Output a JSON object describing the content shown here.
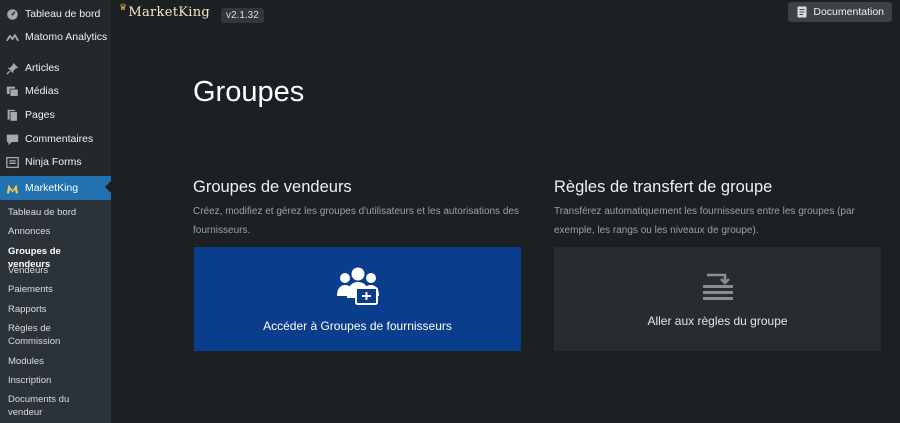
{
  "sidebar": {
    "items": [
      {
        "label": "Tableau de bord",
        "icon": "dashboard-icon"
      },
      {
        "label": "Matomo Analytics",
        "icon": "analytics-icon"
      },
      {
        "label": "Articles",
        "icon": "pin-icon"
      },
      {
        "label": "Médias",
        "icon": "media-icon"
      },
      {
        "label": "Pages",
        "icon": "pages-icon"
      },
      {
        "label": "Commentaires",
        "icon": "comments-icon"
      },
      {
        "label": "Ninja Forms",
        "icon": "forms-icon"
      },
      {
        "label": "MarketKing",
        "icon": "marketking-icon"
      }
    ],
    "submenu": [
      "Tableau de bord",
      "Annonces",
      "Groupes de vendeurs",
      "Vendeurs",
      "Paiements",
      "Rapports",
      "Règles de Commission",
      "Modules",
      "Inscription",
      "Documents du vendeur"
    ],
    "active_color": "#2271b1"
  },
  "topbar": {
    "logo_text": "MarketKing",
    "version": "v2.1.32",
    "doc_label": "Documentation"
  },
  "main": {
    "title": "Groupes",
    "cards": [
      {
        "title": "Groupes de vendeurs",
        "description": "Créez, modifiez et gérez les groupes d'utilisateurs et les autorisations des fournisseurs.",
        "action": "Accéder à Groupes de fournisseurs",
        "icon": "users-group-icon",
        "color": "#0a3e8c"
      },
      {
        "title": "Règles de transfert de groupe",
        "description": "Transférez automatiquement les fournisseurs entre les groupes (par exemple, les rangs ou les niveaux de groupe).",
        "action": "Aller aux règles du groupe",
        "icon": "transfer-rules-icon",
        "color": "#282c30"
      }
    ]
  }
}
